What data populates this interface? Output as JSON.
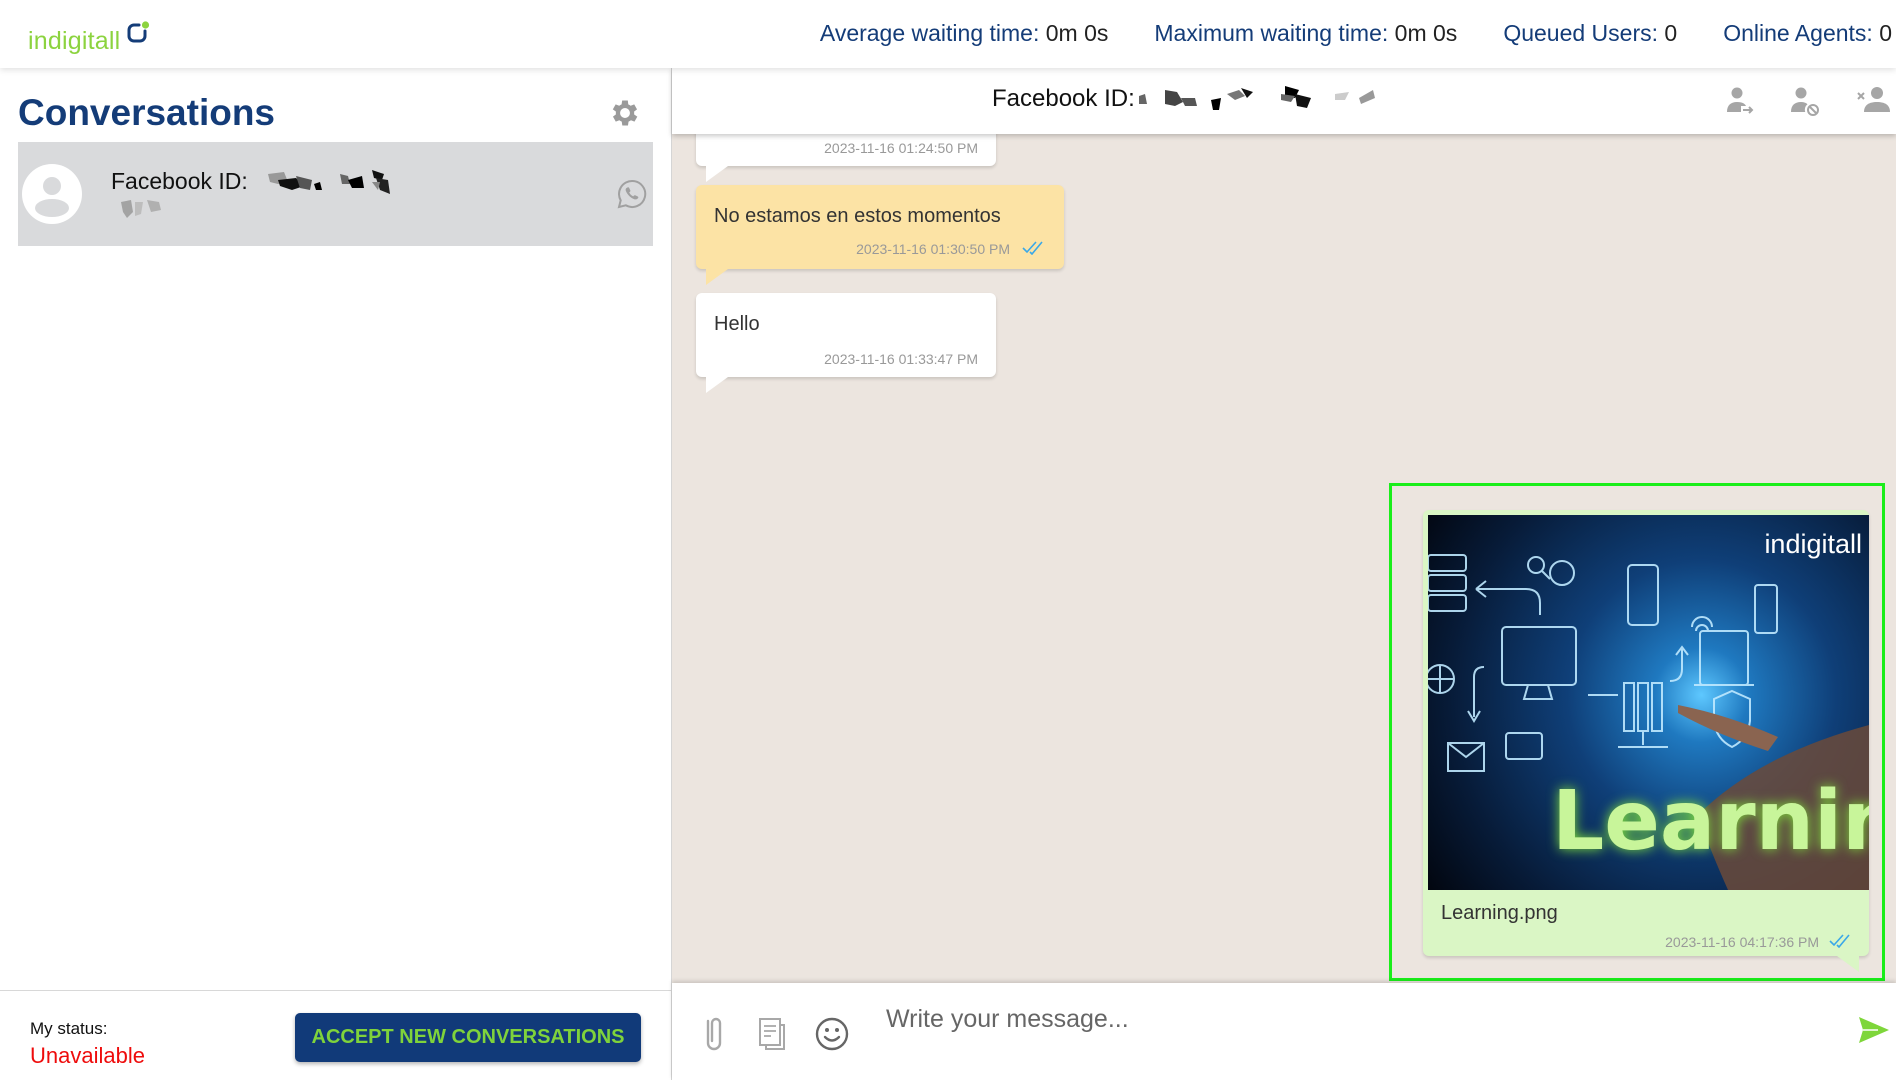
{
  "app": {
    "logo_text": "indigitall",
    "brand_green": "#8cd33f",
    "brand_blue": "#143c78"
  },
  "metrics": [
    {
      "label": "Average waiting time:",
      "value": "0m 0s"
    },
    {
      "label": "Maximum waiting time:",
      "value": "0m 0s"
    },
    {
      "label": "Queued Users:",
      "value": "0"
    },
    {
      "label": "Online Agents:",
      "value": "0"
    }
  ],
  "sidebar": {
    "title": "Conversations",
    "settings_icon": "gear-icon",
    "conversations": [
      {
        "name_label": "Facebook ID:",
        "id_redacted": true,
        "channel_icon": "whatsapp-icon",
        "selected": true
      }
    ],
    "footer": {
      "status_label": "My status:",
      "status_value": "Unavailable",
      "status_color": "#ee0c0c",
      "accept_button": "ACCEPT NEW CONVERSATIONS"
    }
  },
  "chat": {
    "header": {
      "title_label": "Facebook ID:",
      "id_redacted": true,
      "actions": [
        "transfer-user-icon",
        "block-user-icon",
        "remove-user-icon"
      ]
    },
    "messages": [
      {
        "direction": "incoming",
        "text": "",
        "timestamp": "2023-11-16 01:24:50 PM",
        "partially_visible": true
      },
      {
        "direction": "incoming-auto",
        "text": "No estamos en estos momentos",
        "timestamp": "2023-11-16 01:30:50 PM",
        "read": true
      },
      {
        "direction": "incoming",
        "text": "Hello",
        "timestamp": "2023-11-16 01:33:47 PM"
      },
      {
        "direction": "outgoing",
        "type": "image",
        "image_caption_text": "indigitall",
        "image_headline": "Learning",
        "filename": "Learning.png",
        "timestamp": "2023-11-16 04:17:36 PM",
        "read": true,
        "highlighted": true
      }
    ],
    "composer": {
      "placeholder": "Write your message...",
      "value": "",
      "icons": [
        "paperclip-icon",
        "templates-icon",
        "emoji-icon",
        "send-icon"
      ]
    }
  }
}
